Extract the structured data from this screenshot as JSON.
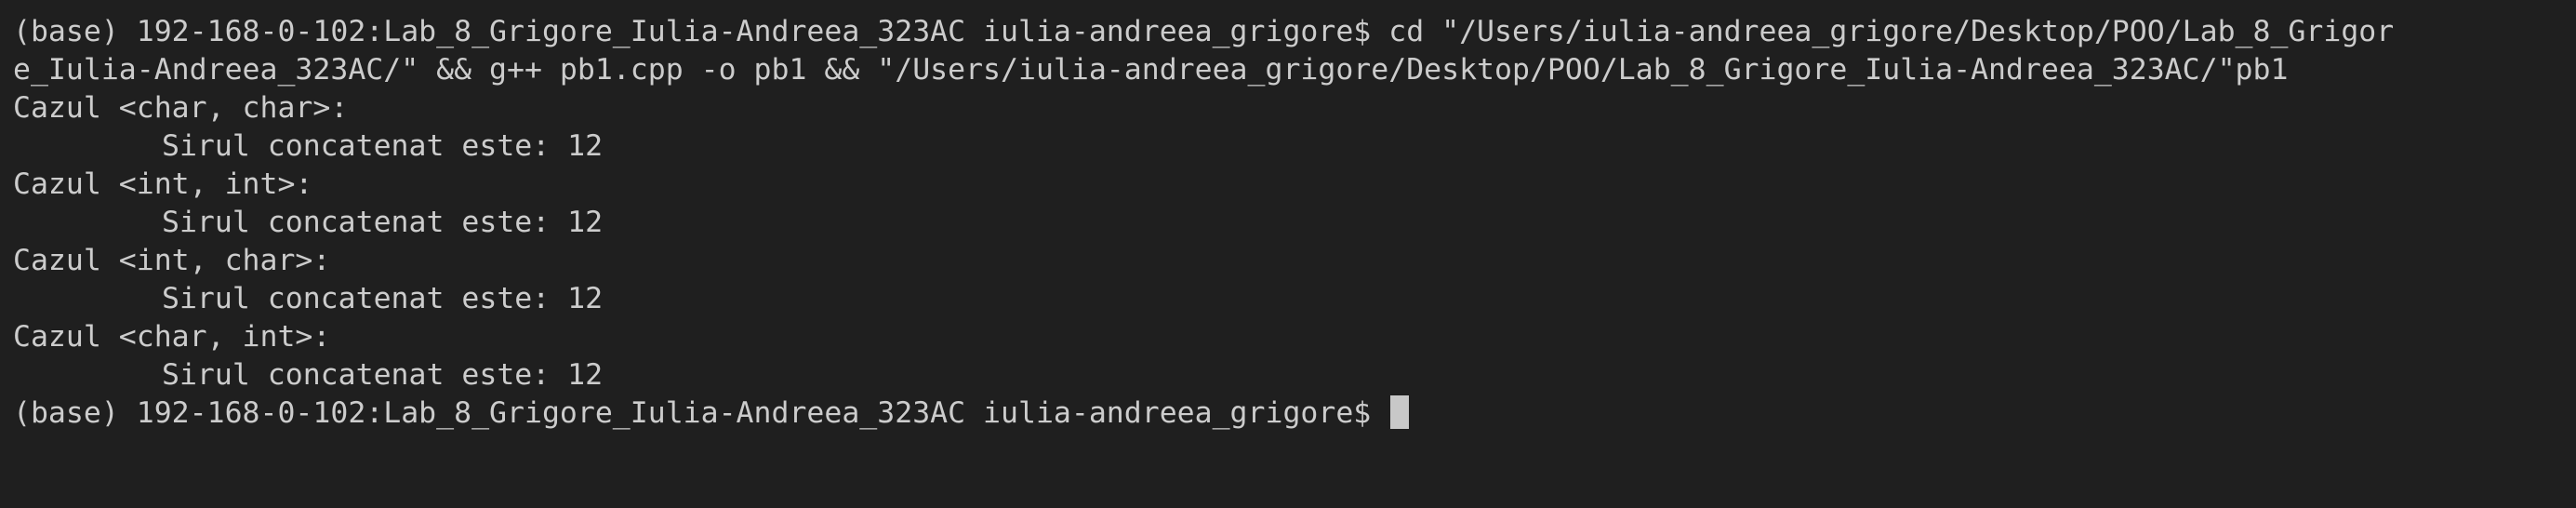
{
  "terminal": {
    "lines": [
      "(base) 192-168-0-102:Lab_8_Grigore_Iulia-Andreea_323AC iulia-andreea_grigore$ cd \"/Users/iulia-andreea_grigore/Desktop/POO/Lab_8_Grigor",
      "e_Iulia-Andreea_323AC/\" && g++ pb1.cpp -o pb1 && \"/Users/iulia-andreea_grigore/Desktop/POO/Lab_8_Grigore_Iulia-Andreea_323AC/\"pb1",
      "Cazul <char, char>:",
      "Sirul concatenat este: 12",
      "Cazul <int, int>:",
      "Sirul concatenat este: 12",
      "Cazul <int, char>:",
      "Sirul concatenat este: 12",
      "Cazul <char, int>:",
      "Sirul concatenat este: 12",
      "(base) 192-168-0-102:Lab_8_Grigore_Iulia-Andreea_323AC iulia-andreea_grigore$ "
    ],
    "colors": {
      "background": "#1f1f1f",
      "text": "#cccccc",
      "cursor": "#c8c8c8"
    }
  }
}
